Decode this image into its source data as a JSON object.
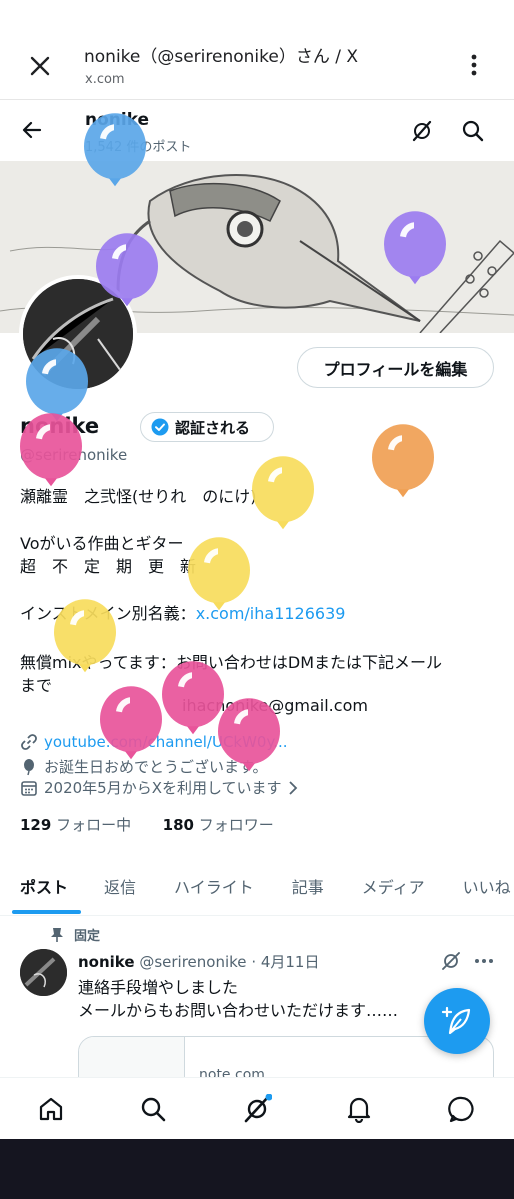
{
  "browser": {
    "title": "nonike（@serirenonike）さん / X",
    "url": "x.com",
    "close_icon": "close-icon",
    "menu_icon": "more-vertical-icon"
  },
  "header": {
    "name": "nonike",
    "post_count": "1,542 件のポスト"
  },
  "profile": {
    "edit_button": "プロフィールを編集",
    "display_name": "nonike",
    "verify_label": "認証される",
    "handle": "@serirenonike",
    "bio_lines": [
      "瀬離霊　之弐怪(せりれ　のにけ)",
      "Voがいる作曲とギター",
      "超　不　定　期　更　新",
      "インストメイン別名義：",
      "x.com/iha1126639",
      "無償mixやってます：お問い合わせはDMまたは下記メール",
      "まで",
      "ihacnonike@gmail.com"
    ],
    "link": "youtube.com/channel/UCkW0y...",
    "birthday": "お誕生日おめでとうございます。",
    "joined": "2020年5月からXを利用しています",
    "following_count": "129",
    "following_label": "フォロー中",
    "followers_count": "180",
    "followers_label": "フォロワー"
  },
  "tabs": [
    "ポスト",
    "返信",
    "ハイライト",
    "記事",
    "メディア",
    "いいね"
  ],
  "post": {
    "pinned_label": "固定",
    "author": "nonike",
    "handle": "@serirenonike",
    "date": "· 4月11日",
    "line1": "連絡手段増やしました",
    "line2": "メールからもお問い合わせいただけます……",
    "card_domain": "note.com"
  },
  "colors": {
    "accent": "#1d9bf0",
    "balloon_blue": "#5aa6e8",
    "balloon_purple": "#9b7cf0",
    "balloon_pink": "#e8549a",
    "balloon_yellow": "#f7dc5c",
    "balloon_orange": "#f0a054"
  }
}
